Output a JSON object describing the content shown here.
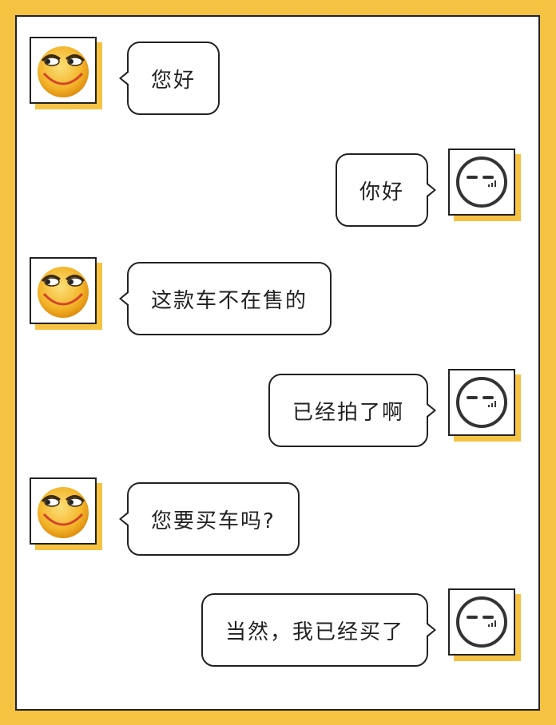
{
  "colors": {
    "background": "#f5c242",
    "frame": "#ffffff",
    "border": "#222222"
  },
  "participants": {
    "left": {
      "avatar_icon": "grin-smiley-face-icon"
    },
    "right": {
      "avatar_icon": "side-eye-face-icon"
    }
  },
  "messages": [
    {
      "side": "left",
      "text": "您好"
    },
    {
      "side": "right",
      "text": "你好"
    },
    {
      "side": "left",
      "text": "这款车不在售的"
    },
    {
      "side": "right",
      "text": "已经拍了啊"
    },
    {
      "side": "left",
      "text": "您要买车吗?"
    },
    {
      "side": "right",
      "text": "当然，我已经买了"
    }
  ]
}
